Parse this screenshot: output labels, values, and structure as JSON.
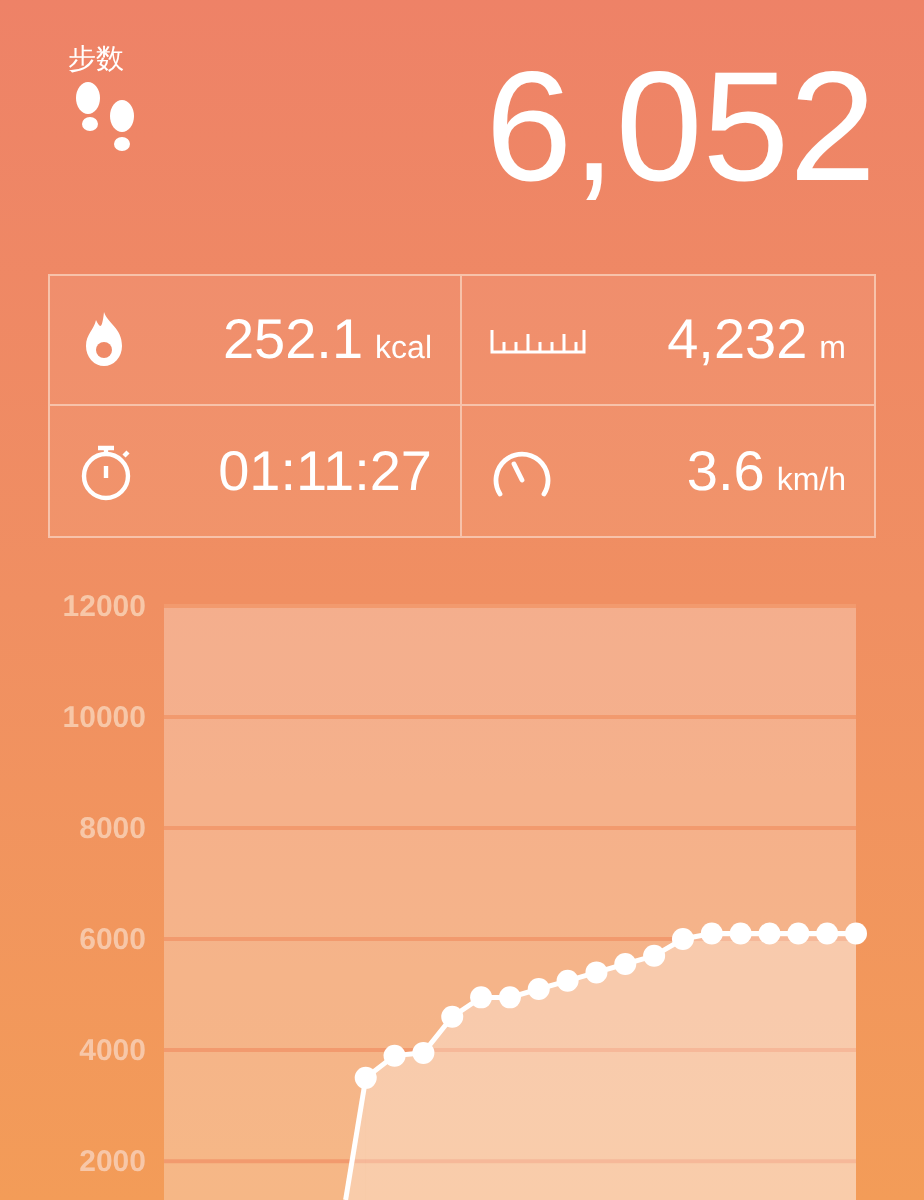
{
  "header": {
    "label": "步数",
    "steps": "6,052"
  },
  "stats": [
    {
      "kind": "calories",
      "value": "252.1",
      "unit": "kcal"
    },
    {
      "kind": "distance",
      "value": "4,232",
      "unit": "m"
    },
    {
      "kind": "duration",
      "value": "01:11:27"
    },
    {
      "kind": "speed",
      "value": "3.6",
      "unit": "km/h"
    }
  ],
  "chart_data": {
    "type": "area",
    "grid": true,
    "marker": "circle",
    "ylim": [
      1300,
      12000
    ],
    "yticks": [
      2000,
      4000,
      6000,
      8000,
      10000,
      12000
    ],
    "values": [
      3500,
      3900,
      3950,
      4600,
      4950,
      4950,
      5100,
      5250,
      5400,
      5550,
      5700,
      6000,
      6100,
      6100,
      6100,
      6100,
      6100,
      6100
    ]
  }
}
